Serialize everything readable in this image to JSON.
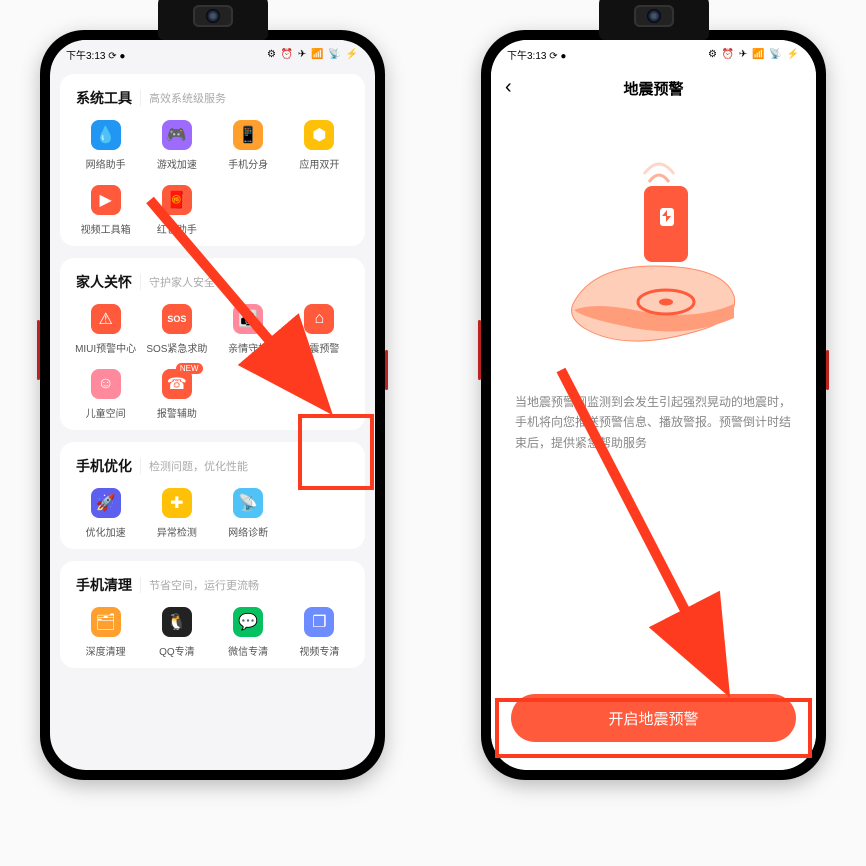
{
  "statusbar": {
    "time": "下午3:13 ⟳ ●",
    "right": "⚙ ⏰ ✈ 📶 📡 ⚡"
  },
  "left": {
    "sections": [
      {
        "title": "系统工具",
        "subtitle": "高效系统级服务",
        "items": [
          {
            "label": "网络助手",
            "color": "c-blue",
            "glyph": "💧"
          },
          {
            "label": "游戏加速",
            "color": "c-purple",
            "glyph": "🎮"
          },
          {
            "label": "手机分身",
            "color": "c-orange",
            "glyph": "📱"
          },
          {
            "label": "应用双开",
            "color": "c-yellow",
            "glyph": "⬢"
          },
          {
            "label": "视频工具箱",
            "color": "c-red",
            "glyph": "▶"
          },
          {
            "label": "红包助手",
            "color": "c-red",
            "glyph": "🧧"
          }
        ]
      },
      {
        "title": "家人关怀",
        "subtitle": "守护家人安全",
        "items": [
          {
            "label": "MIUI预警中心",
            "color": "c-red",
            "glyph": "⚠"
          },
          {
            "label": "SOS紧急求助",
            "color": "c-red",
            "glyph": "SOS",
            "sos": true
          },
          {
            "label": "亲情守护",
            "color": "c-pink",
            "glyph": "👪"
          },
          {
            "label": "地震预警",
            "color": "c-red",
            "glyph": "⌂",
            "highlight": true
          },
          {
            "label": "儿童空间",
            "color": "c-pink",
            "glyph": "☺"
          },
          {
            "label": "报警辅助",
            "color": "c-red",
            "glyph": "☎",
            "new": true
          }
        ]
      },
      {
        "title": "手机优化",
        "subtitle": "检测问题，优化性能",
        "items": [
          {
            "label": "优化加速",
            "color": "c-deep",
            "glyph": "🚀"
          },
          {
            "label": "异常检测",
            "color": "c-yellow",
            "glyph": "✚"
          },
          {
            "label": "网络诊断",
            "color": "c-lblue",
            "glyph": "📡"
          }
        ]
      },
      {
        "title": "手机清理",
        "subtitle": "节省空间，运行更流畅",
        "items": [
          {
            "label": "深度清理",
            "color": "c-orange",
            "glyph": "🗂"
          },
          {
            "label": "QQ专清",
            "color": "c-black",
            "glyph": "🐧"
          },
          {
            "label": "微信专清",
            "color": "c-wechat",
            "glyph": "💬"
          },
          {
            "label": "视频专清",
            "color": "c-box",
            "glyph": "❐"
          }
        ]
      }
    ],
    "new_badge": "NEW"
  },
  "right": {
    "title": "地震预警",
    "desc": "当地震预警网监测到会发生引起强烈晃动的地震时，手机将向您推送预警信息、播放警报。预警倒计时结束后，提供紧急帮助服务",
    "button": "开启地震预警"
  }
}
